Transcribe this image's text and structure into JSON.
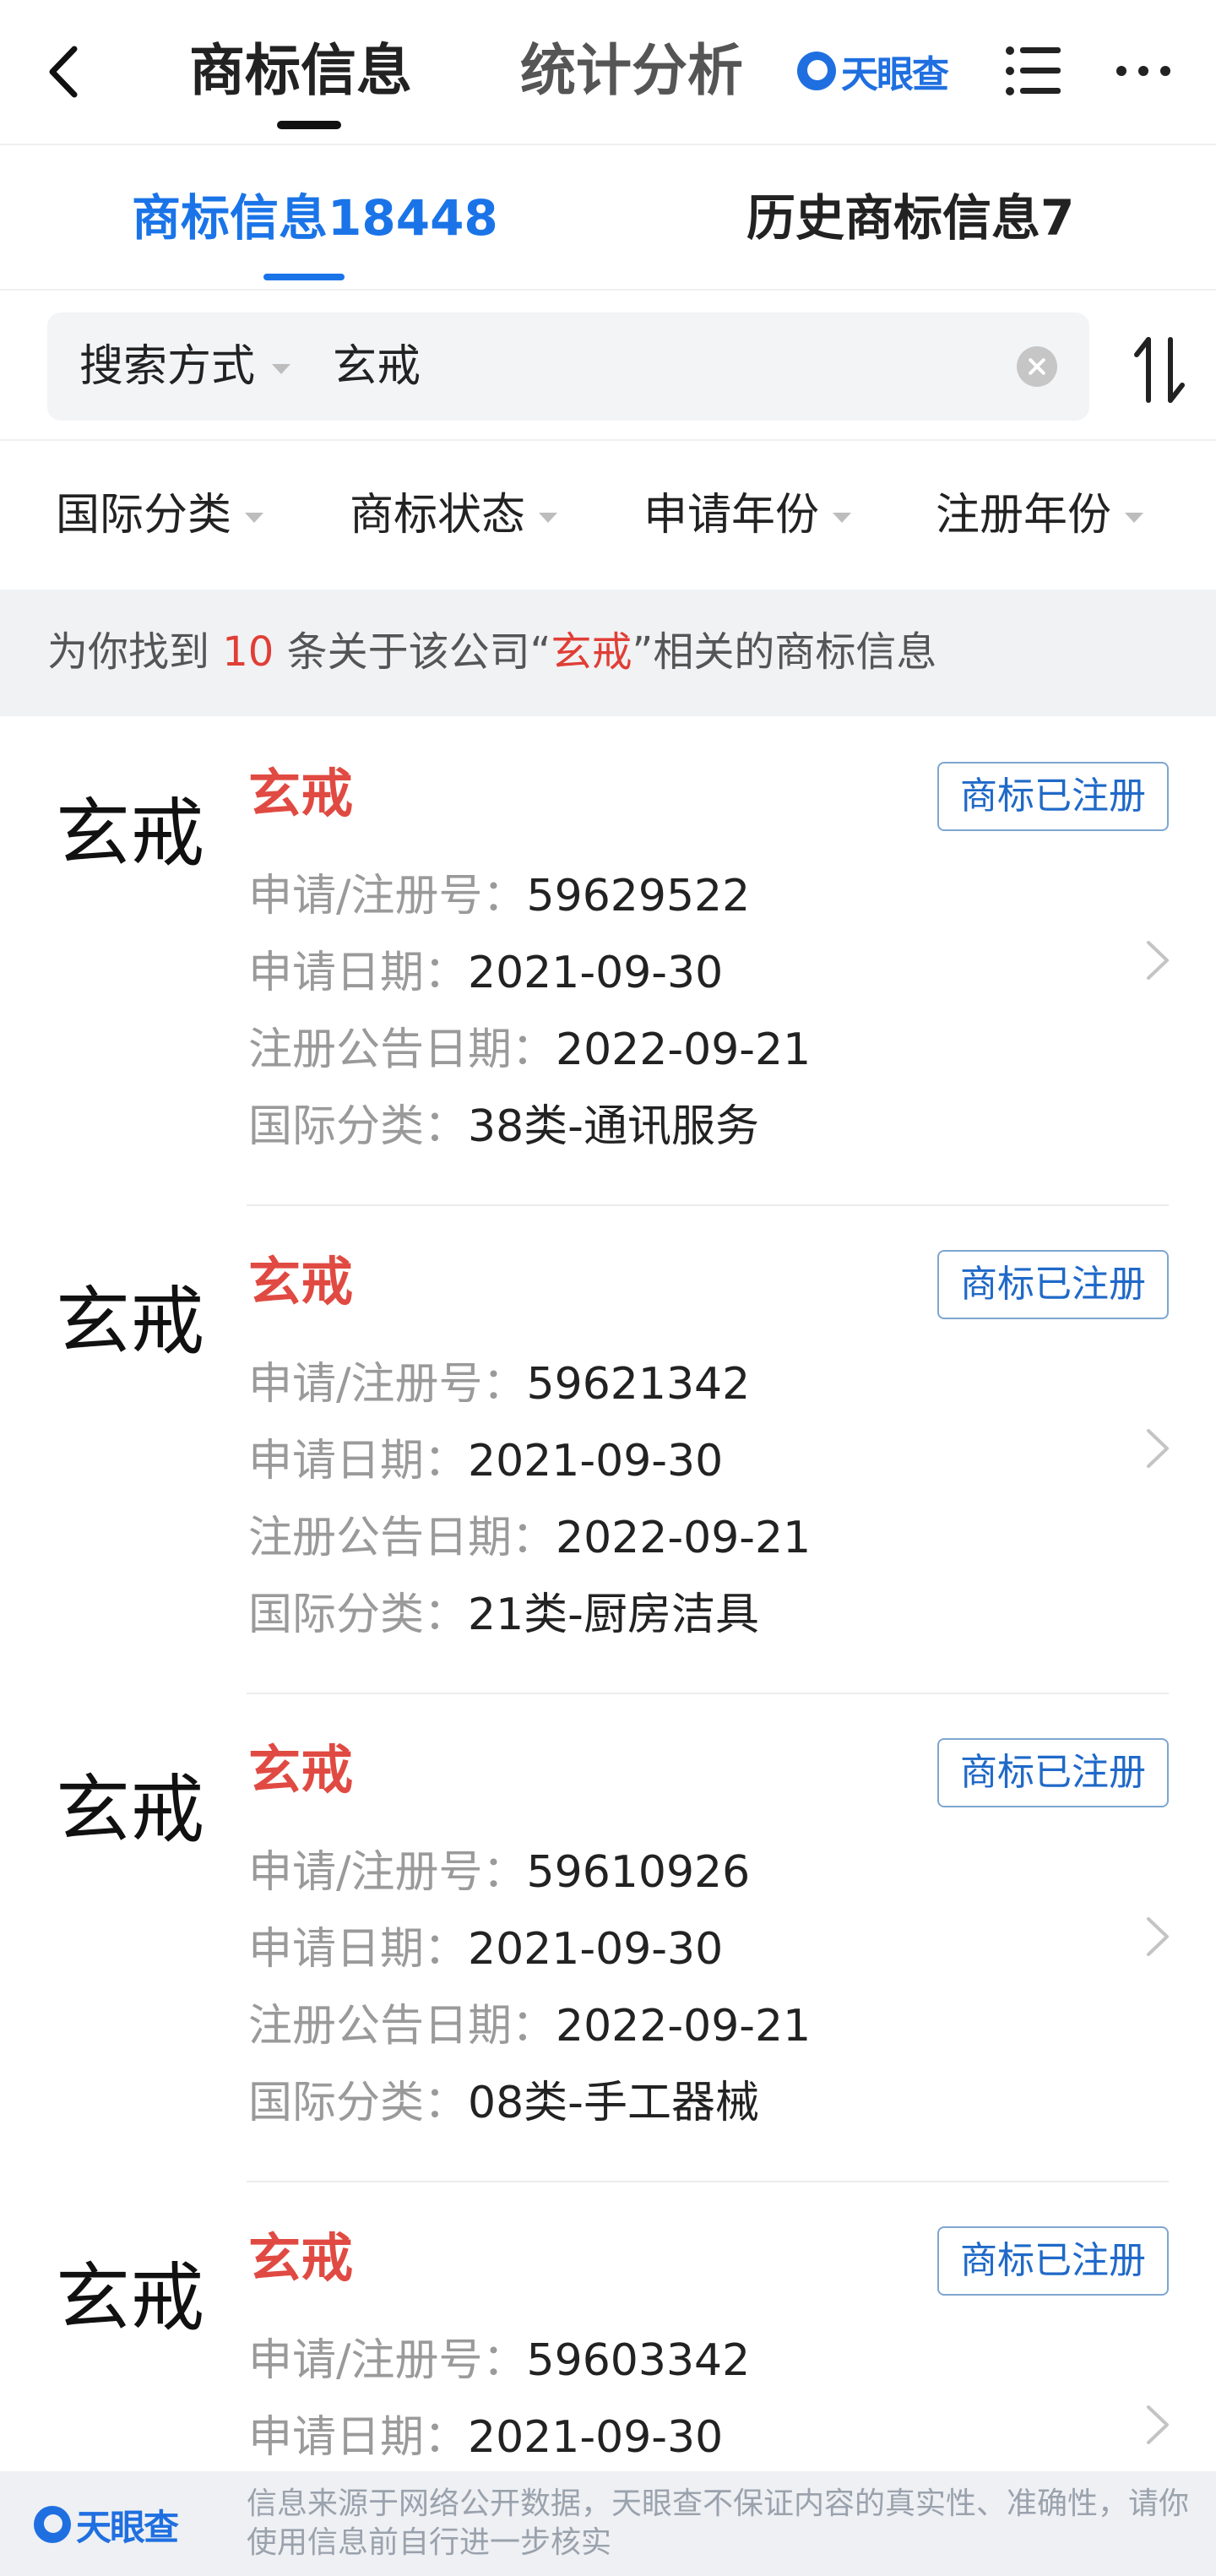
{
  "header": {
    "tabs": [
      {
        "label": "商标信息"
      },
      {
        "label": "统计分析"
      }
    ],
    "logo_text": "天眼查"
  },
  "subtabs": [
    {
      "label": "商标信息18448"
    },
    {
      "label": "历史商标信息7"
    }
  ],
  "search": {
    "mode_label": "搜索方式",
    "value": "玄戒"
  },
  "filters": [
    {
      "label": "国际分类"
    },
    {
      "label": "商标状态"
    },
    {
      "label": "申请年份"
    },
    {
      "label": "注册年份"
    }
  ],
  "notice": {
    "prefix": "为你找到 ",
    "count": "10",
    "middle": " 条关于该公司“",
    "keyword": "玄戒",
    "suffix": "”相关的商标信息"
  },
  "labels": {
    "reg_no": "申请/注册号：",
    "apply_date": "申请日期：",
    "announce_date": "注册公告日期：",
    "intl_class": "国际分类："
  },
  "trademarks": [
    {
      "logo_text": "玄戒",
      "name": "玄戒",
      "status": "商标已注册",
      "reg_no": "59629522",
      "apply_date": "2021-09-30",
      "announce_date": "2022-09-21",
      "intl_class": "38类-通讯服务"
    },
    {
      "logo_text": "玄戒",
      "name": "玄戒",
      "status": "商标已注册",
      "reg_no": "59621342",
      "apply_date": "2021-09-30",
      "announce_date": "2022-09-21",
      "intl_class": "21类-厨房洁具"
    },
    {
      "logo_text": "玄戒",
      "name": "玄戒",
      "status": "商标已注册",
      "reg_no": "59610926",
      "apply_date": "2021-09-30",
      "announce_date": "2022-09-21",
      "intl_class": "08类-手工器械"
    },
    {
      "logo_text": "玄戒",
      "name": "玄戒",
      "status": "商标已注册",
      "reg_no": "59603342",
      "apply_date": "2021-09-30"
    }
  ],
  "footer": {
    "logo_text": "天眼查",
    "disclaimer": "信息来源于网络公开数据，天眼查不保证内容的真实性、准确性，请你使用信息前自行进一步核实"
  },
  "colors": {
    "accent_blue": "#1a74e8",
    "brand_red": "#e04a42",
    "status_border": "#7fa6d0"
  }
}
